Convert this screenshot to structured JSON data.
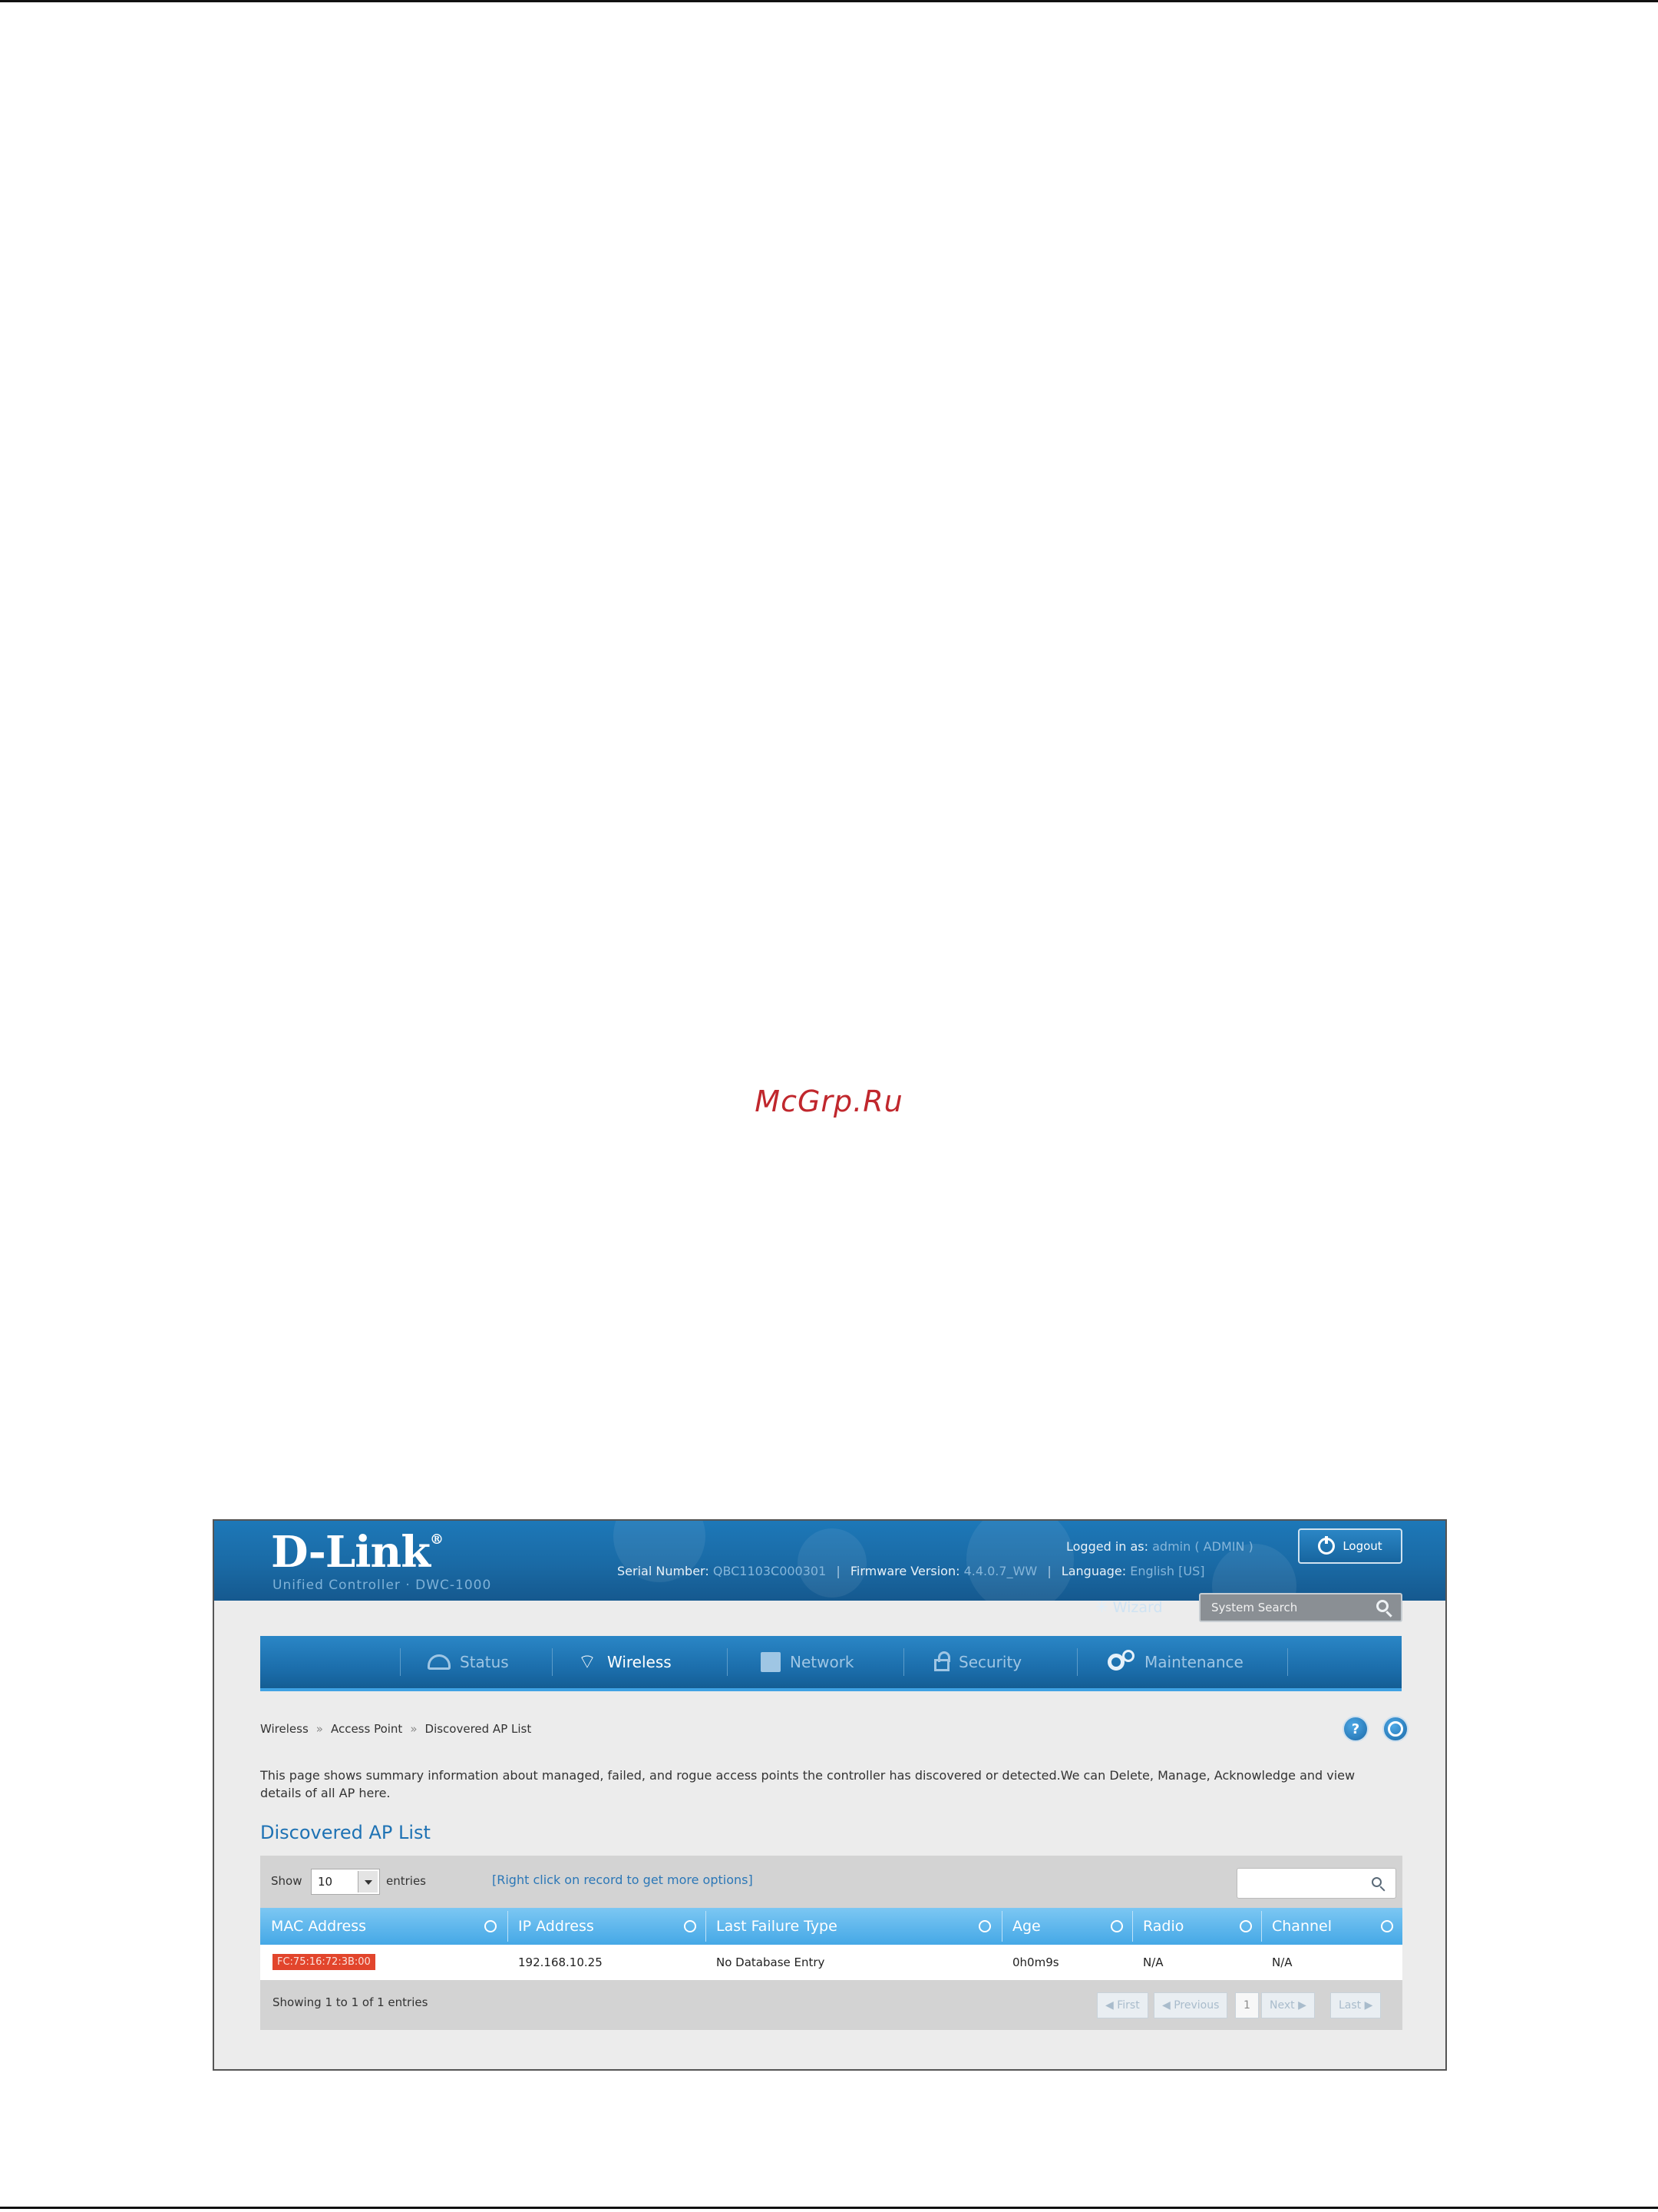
{
  "watermark": "McGrp.Ru",
  "header": {
    "logo": "D-Link",
    "logo_mark": "®",
    "product": "Unified Controller · DWC-1000",
    "serial_label": "Serial Number:",
    "serial_value": "QBC1103C000301",
    "firmware_label": "Firmware Version:",
    "firmware_value": "4.4.0.7_WW",
    "language_label": "Language:",
    "language_value": "English [US]",
    "logged_label": "Logged in as:",
    "logged_value": "admin ( ADMIN )",
    "logout_label": "Logout",
    "wizard_label": "Wizard",
    "system_search_placeholder": "System Search"
  },
  "nav": {
    "items": [
      {
        "label": "Status",
        "icon": "gauge-icon"
      },
      {
        "label": "Wireless",
        "icon": "wifi-icon"
      },
      {
        "label": "Network",
        "icon": "network-icon"
      },
      {
        "label": "Security",
        "icon": "lock-icon"
      },
      {
        "label": "Maintenance",
        "icon": "gear-icon"
      }
    ],
    "active": "Wireless"
  },
  "breadcrumb": {
    "items": [
      "Wireless",
      "Access Point",
      "Discovered AP List"
    ],
    "separator": "»"
  },
  "page": {
    "description": "This page shows summary information about managed, failed, and rogue access points the controller has discovered or detected.We can Delete, Manage, Acknowledge and view details of all AP here.",
    "title": "Discovered AP List"
  },
  "table": {
    "show_label": "Show",
    "entries_value": "10",
    "entries_label": "entries",
    "right_click_hint": "[Right click on record to get more options]",
    "columns": [
      "MAC Address",
      "IP Address",
      "Last Failure Type",
      "Age",
      "Radio",
      "Channel"
    ],
    "rows": [
      {
        "mac": "FC:75:16:72:3B:00",
        "ip": "192.168.10.25",
        "failure": "No Database Entry",
        "age": "0h0m9s",
        "radio": "N/A",
        "channel": "N/A"
      }
    ],
    "showing": "Showing 1 to 1 of 1 entries",
    "pagination": {
      "first": "First",
      "previous": "Previous",
      "page": "1",
      "next": "Next",
      "last": "Last"
    }
  },
  "colors": {
    "header_blue": "#1a6aa5",
    "accent_blue": "#45a8e6",
    "mac_highlight": "#e2452c",
    "watermark": "#c0272d"
  }
}
